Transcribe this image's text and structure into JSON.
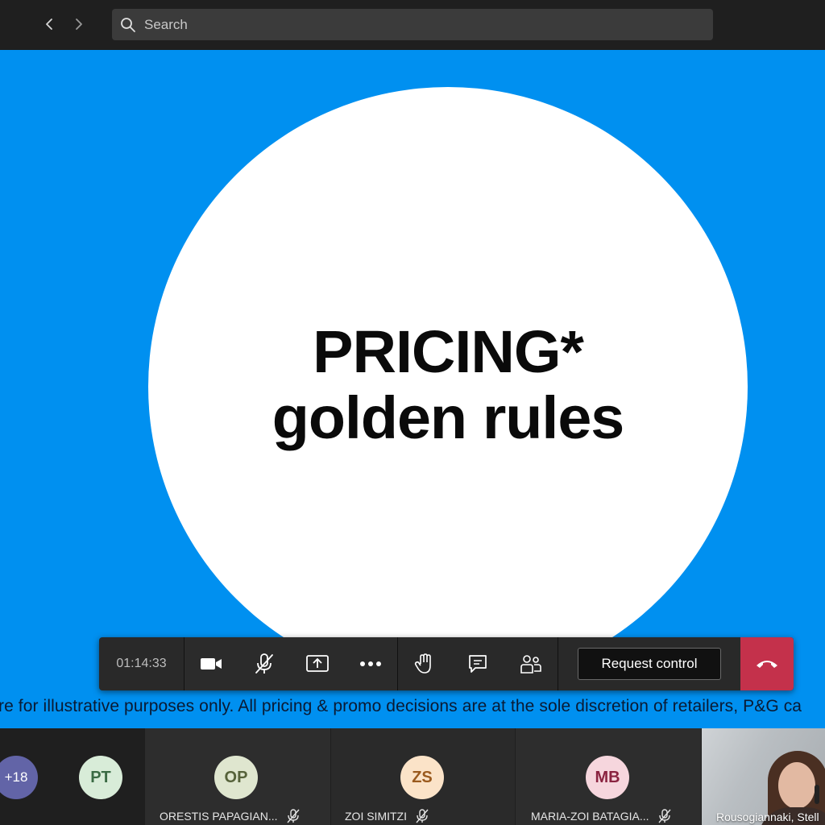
{
  "search": {
    "placeholder": "Search"
  },
  "slide": {
    "title_line1": "PRICING*",
    "title_line2": "golden rules",
    "disclaimer": "re for illustrative purposes only. All pricing & promo decisions are at the sole discretion of retailers, P&G ca",
    "background_color": "#0090f0"
  },
  "controls": {
    "timer": "01:14:33",
    "request_control_label": "Request control",
    "hangup_color": "#c4314b"
  },
  "participants": {
    "more_count": "+18",
    "tiles": [
      {
        "initials": "PT",
        "name": ""
      },
      {
        "initials": "OP",
        "name": "ORESTIS PAPAGIAN..."
      },
      {
        "initials": "ZS",
        "name": "ZOI SIMITZI"
      },
      {
        "initials": "MB",
        "name": "MARIA-ZOI BATAGIA..."
      }
    ],
    "video_name": "Rousogiannaki, Stell"
  }
}
